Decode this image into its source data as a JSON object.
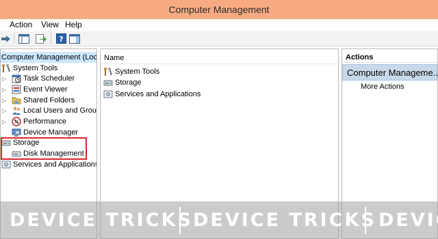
{
  "window": {
    "title": "Computer Management"
  },
  "menu": [
    "Action",
    "View",
    "Help"
  ],
  "colors": {
    "titlebar": "#f7aa82",
    "selection": "#cce8ff",
    "actions_selected": "#c8d9ea",
    "highlight": "#d8262c"
  },
  "tree": {
    "root": "Computer Management (Local",
    "system_tools": "System Tools",
    "task_scheduler": "Task Scheduler",
    "event_viewer": "Event Viewer",
    "shared_folders": "Shared Folders",
    "local_users": "Local Users and Groups",
    "performance": "Performance",
    "device_manager": "Device Manager",
    "storage": "Storage",
    "disk_management": "Disk Management",
    "services": "Services and Applications"
  },
  "center": {
    "header": "Name",
    "items": [
      "System Tools",
      "Storage",
      "Services and Applications"
    ]
  },
  "actions": {
    "header": "Actions",
    "selected": "Computer Manageme...",
    "more": "More Actions"
  },
  "watermark": {
    "text": "DEVICE TRICKS",
    "text_partial": "DEVIC"
  }
}
